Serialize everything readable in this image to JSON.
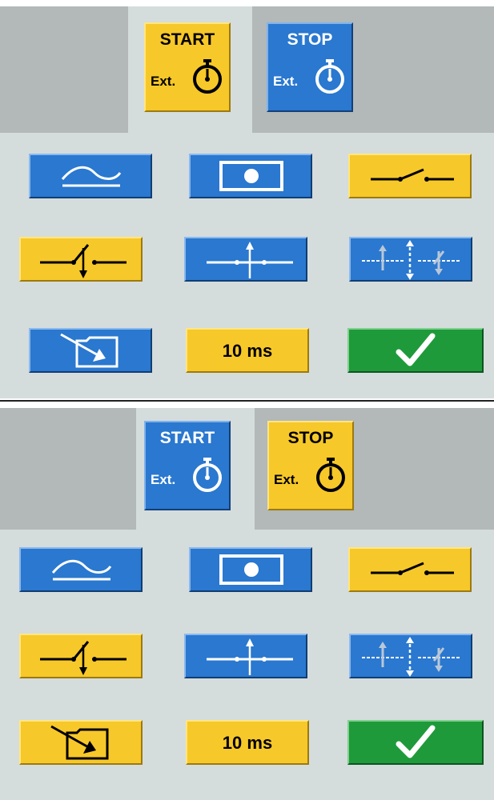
{
  "panels": [
    {
      "start": {
        "title": "START",
        "ext": "Ext.",
        "state": "active"
      },
      "stop": {
        "title": "STOP",
        "ext": "Ext.",
        "state": "inactive"
      },
      "delay": "10 ms",
      "save_button_state": "inactive"
    },
    {
      "start": {
        "title": "START",
        "ext": "Ext.",
        "state": "inactive"
      },
      "stop": {
        "title": "STOP",
        "ext": "Ext.",
        "state": "active"
      },
      "delay": "10 ms",
      "save_button_state": "active"
    }
  ],
  "icons": {
    "analog": "analog-wave-icon",
    "record": "record-icon",
    "contact_open": "contact-open-icon",
    "contact_falling": "contact-falling-edge-icon",
    "contact_rising": "contact-rising-edge-icon",
    "contact_both": "contact-both-edges-icon",
    "save": "save-to-folder-icon",
    "confirm": "check-icon",
    "stopwatch": "stopwatch-icon"
  },
  "colors": {
    "active_yellow": "#f7c829",
    "inactive_blue": "#2a78cf",
    "confirm_green": "#1f9a3a",
    "panel_bg": "#d5dcdc",
    "header_gray": "#b3b8b8"
  }
}
